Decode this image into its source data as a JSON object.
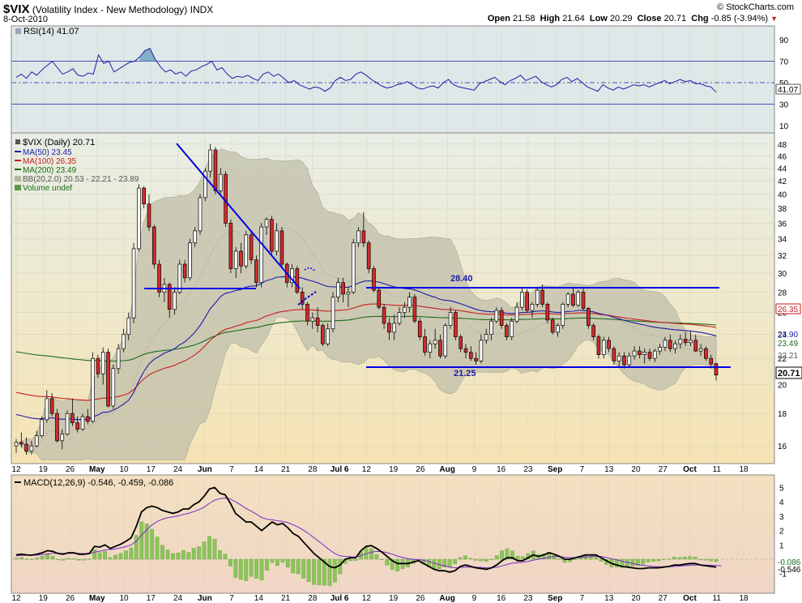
{
  "header": {
    "symbol": "$VIX",
    "name": "(Volatility Index - New Methodology)",
    "exchange": "INDX",
    "date": "8-Oct-2010",
    "brand": "© StockCharts.com",
    "open_label": "Open",
    "open": "21.58",
    "high_label": "High",
    "high": "21.64",
    "low_label": "Low",
    "low": "20.29",
    "close_label": "Close",
    "close": "20.71",
    "chg_label": "Chg",
    "chg": "-0.85 (-3.94%)",
    "chg_arrow": "▼"
  },
  "colors": {
    "panel_bg": "#f3e6b8",
    "candle_up": "#ffffff",
    "candle_down": "#d42a2a",
    "ma50": "#1c1ca8",
    "ma100": "#c81e1e",
    "ma200": "#1a6d1a",
    "bb_fill": "#c0bfab",
    "trendline": "#0000e6",
    "macd_line": "#000000",
    "signal_line": "#7a2ac8",
    "histogram": "#8cc45a"
  },
  "legend": {
    "price": "$VIX (Daily) 20.71",
    "ma50": "MA(50) 23.45",
    "ma100": "MA(100) 26.35",
    "ma200": "MA(200) 23.49",
    "bb": "BB(20,2.0) 20.53 - 22.21 - 23.89",
    "volume": "Volume undef"
  },
  "rsi": {
    "label": "RSI(14) 41.07",
    "current": "41.07",
    "ticks": [
      "90",
      "70",
      "50",
      "30",
      "10"
    ]
  },
  "macd": {
    "label": "MACD(12,26,9) -0.546, -0.459, -0.086",
    "current_macd": "-0.546",
    "current_hist": "-0.086",
    "ticks": [
      "5",
      "4",
      "3",
      "2",
      "1",
      "-1"
    ]
  },
  "annotations": {
    "resistance": "28.40",
    "support": "21.25"
  },
  "price_tags": {
    "ma100": "26.35",
    "ma200_ma50": "23.90",
    "bb_up": "23.49",
    "bb_mid": "22.21",
    "last": "20.71"
  },
  "chart_data": {
    "type": "candlestick",
    "title": "$VIX (Volatility Index - New Methodology) INDX",
    "yaxis_scale": "log",
    "ylim": [
      15,
      50
    ],
    "y_ticks": [
      16,
      18,
      20,
      22,
      24,
      26,
      28,
      30,
      32,
      34,
      36,
      38,
      40,
      42,
      44,
      46,
      48
    ],
    "x_tick_labels": [
      "12",
      "19",
      "26",
      "May",
      "10",
      "17",
      "24",
      "Jun",
      "7",
      "14",
      "21",
      "28",
      "Jul 6",
      "12",
      "19",
      "26",
      "Aug",
      "9",
      "16",
      "23",
      "Sep",
      "7",
      "13",
      "20",
      "27",
      "Oct",
      "11",
      "18"
    ],
    "candles": [
      [
        16.0,
        16.4,
        15.6,
        16.2
      ],
      [
        16.2,
        16.8,
        15.9,
        16.1
      ],
      [
        16.1,
        16.5,
        15.5,
        15.7
      ],
      [
        15.7,
        16.3,
        15.5,
        16.0
      ],
      [
        16.0,
        16.9,
        15.9,
        16.6
      ],
      [
        16.6,
        17.8,
        16.5,
        17.6
      ],
      [
        17.6,
        19.6,
        17.4,
        19.0
      ],
      [
        19.0,
        19.4,
        17.8,
        18.0
      ],
      [
        18.0,
        18.3,
        16.2,
        16.3
      ],
      [
        16.3,
        17.0,
        15.8,
        16.7
      ],
      [
        16.7,
        18.2,
        16.6,
        18.0
      ],
      [
        18.0,
        19.0,
        17.2,
        17.4
      ],
      [
        17.4,
        17.8,
        16.8,
        17.0
      ],
      [
        17.0,
        18.0,
        16.9,
        17.8
      ],
      [
        17.8,
        18.3,
        17.3,
        17.5
      ],
      [
        17.5,
        22.5,
        17.4,
        22.0
      ],
      [
        22.0,
        22.3,
        20.5,
        20.8
      ],
      [
        20.8,
        22.9,
        20.0,
        22.5
      ],
      [
        22.5,
        22.8,
        18.4,
        18.5
      ],
      [
        18.5,
        21.5,
        18.3,
        21.2
      ],
      [
        21.2,
        23.2,
        20.8,
        22.8
      ],
      [
        22.8,
        24.5,
        22.5,
        24.0
      ],
      [
        24.0,
        26.0,
        23.5,
        25.5
      ],
      [
        25.5,
        33.5,
        25.0,
        32.8
      ],
      [
        32.8,
        41.5,
        32.5,
        40.9
      ],
      [
        40.9,
        41.2,
        38.0,
        38.6
      ],
      [
        38.6,
        40.0,
        35.0,
        35.5
      ],
      [
        35.5,
        35.8,
        30.5,
        31.0
      ],
      [
        31.0,
        31.5,
        27.5,
        28.0
      ],
      [
        28.0,
        29.5,
        27.0,
        28.8
      ],
      [
        28.8,
        29.0,
        25.5,
        26.3
      ],
      [
        26.3,
        28.5,
        25.8,
        28.0
      ],
      [
        28.0,
        31.5,
        27.8,
        31.0
      ],
      [
        31.0,
        31.5,
        29.0,
        29.5
      ],
      [
        29.5,
        34.0,
        29.2,
        33.5
      ],
      [
        33.5,
        35.5,
        33.0,
        35.0
      ],
      [
        35.0,
        40.0,
        34.5,
        39.5
      ],
      [
        39.5,
        44.0,
        39.0,
        43.5
      ],
      [
        43.5,
        48.0,
        42.5,
        47.0
      ],
      [
        47.0,
        47.5,
        40.0,
        40.5
      ],
      [
        40.5,
        44.0,
        40.0,
        43.0
      ],
      [
        43.0,
        43.5,
        35.5,
        36.0
      ],
      [
        36.0,
        36.5,
        30.0,
        30.5
      ],
      [
        30.5,
        33.0,
        29.5,
        32.5
      ],
      [
        32.5,
        33.5,
        30.0,
        30.8
      ],
      [
        30.8,
        35.0,
        30.5,
        34.5
      ],
      [
        34.5,
        35.0,
        31.0,
        31.5
      ],
      [
        31.5,
        32.0,
        28.5,
        29.0
      ],
      [
        29.0,
        36.0,
        28.5,
        35.5
      ],
      [
        35.5,
        36.8,
        34.5,
        36.5
      ],
      [
        36.5,
        37.0,
        32.0,
        32.5
      ],
      [
        32.5,
        36.0,
        32.0,
        35.0
      ],
      [
        35.0,
        35.5,
        30.5,
        31.0
      ],
      [
        31.0,
        31.2,
        28.5,
        29.0
      ],
      [
        29.0,
        31.0,
        28.5,
        30.5
      ],
      [
        30.5,
        30.8,
        27.8,
        28.0
      ],
      [
        28.0,
        28.5,
        26.3,
        26.8
      ],
      [
        26.8,
        27.0,
        24.8,
        25.2
      ],
      [
        25.2,
        26.0,
        24.5,
        25.5
      ],
      [
        25.5,
        26.5,
        24.2,
        24.8
      ],
      [
        24.8,
        25.0,
        23.0,
        23.2
      ],
      [
        23.2,
        25.0,
        23.0,
        24.5
      ],
      [
        24.5,
        28.0,
        24.2,
        27.5
      ],
      [
        27.5,
        29.5,
        27.0,
        29.0
      ],
      [
        29.0,
        29.5,
        27.0,
        27.8
      ],
      [
        27.8,
        28.5,
        26.5,
        28.0
      ],
      [
        28.0,
        34.0,
        27.8,
        33.5
      ],
      [
        33.5,
        35.5,
        33.0,
        35.0
      ],
      [
        35.0,
        37.5,
        33.0,
        33.5
      ],
      [
        33.5,
        33.8,
        30.0,
        30.5
      ],
      [
        30.5,
        30.8,
        28.0,
        28.2
      ],
      [
        28.2,
        28.5,
        26.3,
        26.5
      ],
      [
        26.5,
        26.8,
        24.5,
        25.0
      ],
      [
        25.0,
        25.5,
        23.5,
        24.2
      ],
      [
        24.2,
        25.8,
        23.5,
        25.0
      ],
      [
        25.0,
        26.5,
        24.8,
        26.0
      ],
      [
        26.0,
        27.0,
        25.5,
        26.5
      ],
      [
        26.5,
        28.0,
        26.0,
        27.5
      ],
      [
        27.5,
        27.8,
        25.0,
        25.2
      ],
      [
        25.2,
        25.5,
        23.5,
        23.8
      ],
      [
        23.8,
        24.5,
        22.2,
        22.5
      ],
      [
        22.5,
        23.5,
        22.0,
        23.2
      ],
      [
        23.2,
        24.5,
        22.8,
        23.5
      ],
      [
        23.5,
        24.0,
        22.0,
        22.2
      ],
      [
        22.2,
        25.0,
        22.0,
        24.8
      ],
      [
        24.8,
        26.5,
        24.5,
        26.0
      ],
      [
        26.0,
        26.2,
        23.5,
        23.8
      ],
      [
        23.8,
        24.0,
        22.5,
        22.8
      ],
      [
        22.8,
        23.2,
        22.0,
        22.5
      ],
      [
        22.5,
        23.0,
        21.8,
        22.0
      ],
      [
        22.0,
        22.5,
        21.5,
        21.8
      ],
      [
        21.8,
        24.0,
        21.6,
        23.5
      ],
      [
        23.5,
        24.5,
        23.2,
        24.0
      ],
      [
        24.0,
        25.5,
        23.5,
        25.2
      ],
      [
        25.2,
        26.5,
        25.0,
        26.2
      ],
      [
        26.2,
        26.5,
        24.5,
        24.8
      ],
      [
        24.8,
        25.0,
        23.5,
        23.8
      ],
      [
        23.8,
        25.5,
        23.5,
        25.2
      ],
      [
        25.2,
        27.0,
        25.0,
        26.5
      ],
      [
        26.5,
        28.5,
        26.2,
        28.0
      ],
      [
        28.0,
        28.3,
        26.0,
        26.2
      ],
      [
        26.2,
        27.0,
        25.5,
        26.8
      ],
      [
        26.8,
        28.5,
        26.5,
        28.2
      ],
      [
        28.2,
        28.8,
        26.5,
        26.8
      ],
      [
        26.8,
        27.0,
        25.0,
        25.3
      ],
      [
        25.3,
        25.5,
        24.0,
        24.2
      ],
      [
        24.2,
        25.0,
        23.8,
        24.8
      ],
      [
        24.8,
        27.0,
        24.5,
        26.8
      ],
      [
        26.8,
        28.0,
        26.5,
        27.8
      ],
      [
        27.8,
        28.5,
        26.5,
        26.7
      ],
      [
        26.7,
        28.2,
        26.5,
        28.0
      ],
      [
        28.0,
        28.5,
        26.2,
        26.4
      ],
      [
        26.4,
        26.5,
        24.5,
        24.8
      ],
      [
        24.8,
        25.0,
        23.5,
        23.8
      ],
      [
        23.8,
        24.0,
        22.0,
        22.3
      ],
      [
        22.3,
        23.8,
        22.0,
        23.5
      ],
      [
        23.5,
        23.8,
        22.5,
        22.8
      ],
      [
        22.8,
        23.0,
        21.5,
        21.8
      ],
      [
        21.8,
        22.5,
        21.3,
        22.2
      ],
      [
        22.2,
        22.5,
        21.2,
        21.5
      ],
      [
        21.5,
        22.5,
        21.3,
        22.2
      ],
      [
        22.2,
        23.0,
        21.9,
        22.6
      ],
      [
        22.6,
        23.0,
        22.0,
        22.3
      ],
      [
        22.3,
        22.8,
        21.6,
        22.5
      ],
      [
        22.5,
        22.8,
        21.8,
        22.0
      ],
      [
        22.0,
        22.8,
        21.7,
        22.6
      ],
      [
        22.6,
        23.2,
        22.3,
        22.9
      ],
      [
        22.9,
        23.8,
        22.6,
        23.5
      ],
      [
        23.5,
        24.0,
        22.5,
        22.8
      ],
      [
        22.8,
        23.5,
        22.4,
        23.2
      ],
      [
        23.2,
        24.0,
        22.8,
        23.6
      ],
      [
        23.6,
        24.2,
        23.0,
        23.3
      ],
      [
        23.3,
        24.3,
        23.0,
        23.5
      ],
      [
        23.5,
        24.0,
        22.5,
        22.6
      ],
      [
        22.6,
        23.2,
        22.2,
        22.8
      ],
      [
        22.8,
        23.0,
        21.8,
        22.0
      ],
      [
        22.0,
        22.3,
        21.2,
        21.56
      ],
      [
        21.58,
        21.64,
        20.29,
        20.71
      ]
    ],
    "moving_averages": [
      {
        "name": "MA(50)",
        "last": 23.45
      },
      {
        "name": "MA(100)",
        "last": 26.35
      },
      {
        "name": "MA(200)",
        "last": 23.49
      }
    ],
    "bollinger": {
      "name": "BB(20,2.0)",
      "lower": 20.53,
      "middle": 22.21,
      "upper": 23.89
    },
    "levels": [
      {
        "label": "28.40",
        "value": 28.4
      },
      {
        "label": "21.25",
        "value": 21.25
      }
    ],
    "rsi_series": [
      55,
      58,
      54,
      60,
      57,
      62,
      66,
      70,
      64,
      58,
      60,
      63,
      57,
      56,
      59,
      58,
      76,
      68,
      70,
      60,
      63,
      66,
      69,
      70,
      74,
      80,
      82,
      72,
      65,
      60,
      62,
      58,
      60,
      56,
      61,
      62,
      65,
      67,
      70,
      62,
      64,
      58,
      54,
      56,
      55,
      57,
      54,
      52,
      58,
      60,
      56,
      58,
      54,
      50,
      52,
      48,
      46,
      44,
      46,
      45,
      42,
      45,
      52,
      55,
      52,
      53,
      58,
      60,
      57,
      53,
      50,
      47,
      45,
      46,
      48,
      49,
      51,
      48,
      45,
      44,
      46,
      47,
      45,
      50,
      53,
      48,
      46,
      45,
      44,
      43,
      49,
      51,
      53,
      55,
      51,
      48,
      52,
      54,
      57,
      52,
      54,
      56,
      51,
      48,
      46,
      48,
      53,
      55,
      51,
      54,
      50,
      46,
      44,
      42,
      48,
      45,
      43,
      46,
      44,
      46,
      48,
      47,
      48,
      46,
      48,
      50,
      52,
      49,
      51,
      53,
      51,
      52,
      49,
      49,
      47,
      46,
      41.07
    ],
    "macd_series": [
      0.3,
      0.35,
      0.3,
      0.28,
      0.35,
      0.45,
      0.6,
      0.55,
      0.4,
      0.35,
      0.45,
      0.45,
      0.35,
      0.35,
      0.4,
      0.9,
      0.85,
      1.0,
      0.75,
      0.9,
      1.05,
      1.25,
      1.5,
      2.3,
      3.3,
      3.6,
      3.7,
      3.6,
      3.4,
      3.3,
      3.2,
      3.3,
      3.5,
      3.5,
      3.8,
      4.0,
      4.4,
      4.9,
      5.0,
      4.6,
      4.5,
      3.9,
      3.2,
      2.9,
      2.6,
      2.6,
      2.3,
      2.0,
      2.3,
      2.6,
      2.4,
      2.5,
      2.2,
      1.8,
      1.6,
      1.2,
      0.8,
      0.4,
      0.1,
      -0.2,
      -0.5,
      -0.6,
      -0.4,
      0.0,
      0.1,
      0.1,
      0.6,
      0.9,
      0.95,
      0.75,
      0.5,
      0.2,
      -0.1,
      -0.3,
      -0.3,
      -0.3,
      -0.2,
      -0.1,
      -0.3,
      -0.5,
      -0.7,
      -0.8,
      -0.8,
      -0.9,
      -0.8,
      -0.5,
      -0.4,
      -0.5,
      -0.6,
      -0.65,
      -0.7,
      -0.6,
      -0.4,
      -0.1,
      0.1,
      0.1,
      -0.1,
      -0.1,
      0.1,
      0.3,
      0.2,
      0.3,
      0.45,
      0.35,
      0.2,
      0.0,
      0.0,
      0.1,
      0.2,
      0.3,
      0.3,
      0.3,
      0.1,
      -0.1,
      -0.3,
      -0.4,
      -0.5,
      -0.55,
      -0.6,
      -0.65,
      -0.65,
      -0.6,
      -0.6,
      -0.6,
      -0.55,
      -0.5,
      -0.4,
      -0.4,
      -0.35,
      -0.3,
      -0.3,
      -0.4,
      -0.45,
      -0.5,
      -0.546
    ],
    "signal_series": [
      0.25,
      0.27,
      0.28,
      0.28,
      0.29,
      0.32,
      0.37,
      0.41,
      0.41,
      0.4,
      0.41,
      0.42,
      0.4,
      0.39,
      0.39,
      0.49,
      0.56,
      0.65,
      0.67,
      0.72,
      0.79,
      0.88,
      1.0,
      1.26,
      1.67,
      2.06,
      2.39,
      2.63,
      2.79,
      2.89,
      2.95,
      3.02,
      3.12,
      3.2,
      3.32,
      3.45,
      3.64,
      3.9,
      4.12,
      4.22,
      4.27,
      4.2,
      4.0,
      3.78,
      3.54,
      3.35,
      3.14,
      2.91,
      2.79,
      2.75,
      2.68,
      2.64,
      2.55,
      2.4,
      2.24,
      2.03,
      1.78,
      1.5,
      1.22,
      0.94,
      0.65,
      0.4,
      0.24,
      0.19,
      0.17,
      0.16,
      0.25,
      0.38,
      0.49,
      0.54,
      0.53,
      0.46,
      0.35,
      0.22,
      0.12,
      0.04,
      -0.01,
      -0.03,
      -0.08,
      -0.16,
      -0.27,
      -0.38,
      -0.46,
      -0.55,
      -0.6,
      -0.58,
      -0.55,
      -0.54,
      -0.55,
      -0.57,
      -0.6,
      -0.6,
      -0.56,
      -0.47,
      -0.36,
      -0.27,
      -0.24,
      -0.21,
      -0.15,
      -0.06,
      0.0,
      0.06,
      0.14,
      0.18,
      0.18,
      0.14,
      0.11,
      0.11,
      0.13,
      0.16,
      0.19,
      0.21,
      0.19,
      0.13,
      0.04,
      -0.05,
      -0.14,
      -0.22,
      -0.3,
      -0.37,
      -0.43,
      -0.47,
      -0.5,
      -0.52,
      -0.53,
      -0.52,
      -0.5,
      -0.48,
      -0.45,
      -0.42,
      -0.4,
      -0.4,
      -0.41,
      -0.42,
      -0.44,
      -0.459
    ]
  }
}
